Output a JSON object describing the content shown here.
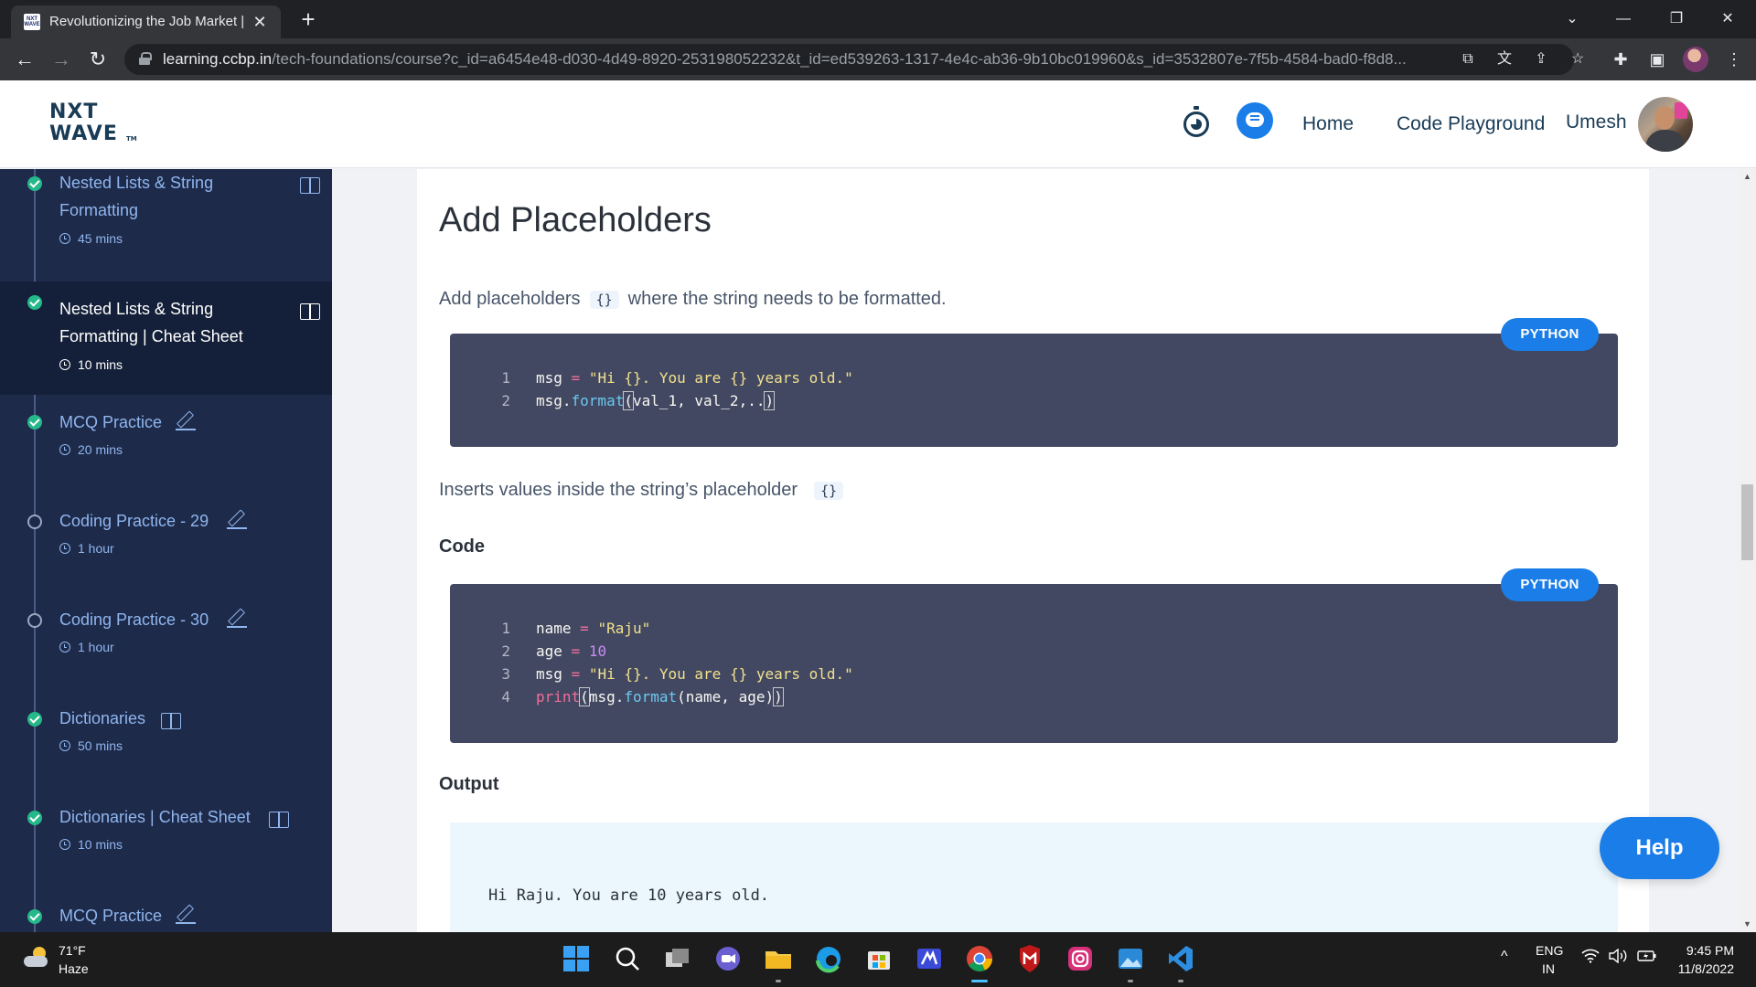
{
  "browser": {
    "tab_title": "Revolutionizing the Job Market |",
    "favicon_text": "NXT WAVE",
    "url_host": "learning.ccbp.in",
    "url_path": "/tech-foundations/course?c_id=a6454e48-d030-4d49-8920-253198052232&t_id=ed539263-1317-4e4c-ab36-9b10bc019960&s_id=3532807e-7f5b-4584-bad0-f8d8...",
    "icons": [
      "back-icon",
      "forward-icon",
      "reload-icon",
      "lock-icon",
      "open-in-new-icon",
      "translate-icon",
      "share-icon",
      "star-icon",
      "extensions-icon",
      "sidepanel-icon",
      "profile-avatar",
      "menu-icon"
    ]
  },
  "header": {
    "logo_line1": "NXT",
    "logo_line2": "WAVE",
    "logo_tm": "TM",
    "nav": [
      "Home",
      "Code Playground"
    ],
    "user_name": "Umesh",
    "accent": "#1b7ee8"
  },
  "sidebar": {
    "bg": "#1e2a4a",
    "items": [
      {
        "title": "Nested Lists & String Formatting",
        "duration": "45 mins",
        "status": "completed",
        "icon": "book-icon"
      },
      {
        "title": "Nested Lists & String Formatting | Cheat Sheet",
        "duration": "10 mins",
        "status": "completed",
        "icon": "book-icon",
        "active": true
      },
      {
        "title": "MCQ Practice",
        "duration": "20 mins",
        "status": "completed",
        "icon": "pencil-icon"
      },
      {
        "title": "Coding Practice - 29",
        "duration": "1 hour",
        "status": "not-started",
        "icon": "pencil-icon"
      },
      {
        "title": "Coding Practice - 30",
        "duration": "1 hour",
        "status": "not-started",
        "icon": "pencil-icon"
      },
      {
        "title": "Dictionaries",
        "duration": "50 mins",
        "status": "completed",
        "icon": "book-icon"
      },
      {
        "title": "Dictionaries | Cheat Sheet",
        "duration": "10 mins",
        "status": "completed",
        "icon": "book-icon"
      },
      {
        "title": "MCQ Practice",
        "duration": "",
        "status": "completed",
        "icon": "pencil-icon"
      }
    ]
  },
  "content": {
    "heading": "Add Placeholders",
    "para1_before": "Add placeholders",
    "para1_chip": "{}",
    "para1_after": "where the string needs to be formatted.",
    "code1": {
      "language": "PYTHON",
      "lines": [
        {
          "n": "1",
          "text": "msg = \"Hi {}. You are {} years old.\""
        },
        {
          "n": "2",
          "text": "msg.format(val_1, val_2,..)"
        }
      ]
    },
    "para2_before": "Inserts values inside the string’s placeholder",
    "para2_chip": "{}",
    "code_heading": "Code",
    "code2": {
      "language": "PYTHON",
      "lines": [
        {
          "n": "1",
          "text": "name = \"Raju\""
        },
        {
          "n": "2",
          "text": "age = 10"
        },
        {
          "n": "3",
          "text": "msg = \"Hi {}. You are {} years old.\""
        },
        {
          "n": "4",
          "text": "print(msg.format(name, age))"
        }
      ]
    },
    "output_heading": "Output",
    "output_text": "Hi Raju. You are 10 years old.",
    "help_label": "Help"
  },
  "taskbar": {
    "weather_temp": "71°F",
    "weather_desc": "Haze",
    "apps": [
      "start-icon",
      "search-icon",
      "task-view-icon",
      "teams-chat-icon",
      "file-explorer-icon",
      "edge-icon",
      "store-icon",
      "app-icon",
      "chrome-icon",
      "mcafee-icon",
      "instagram-icon",
      "photos-icon",
      "vscode-icon"
    ],
    "lang1": "ENG",
    "lang2": "IN",
    "time": "9:45 PM",
    "date": "11/8/2022"
  }
}
